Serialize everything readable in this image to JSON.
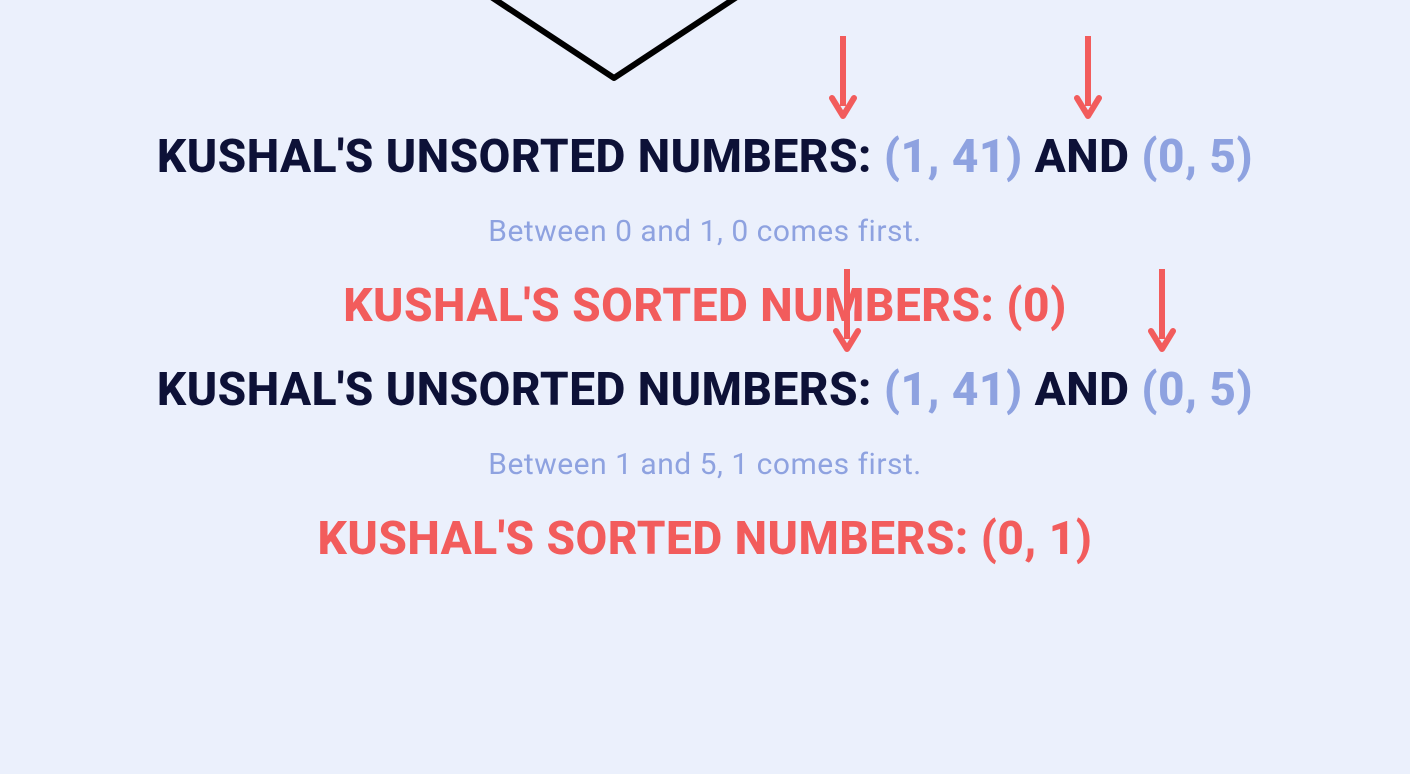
{
  "colors": {
    "bg": "#ebf0fc",
    "dark": "#0d1137",
    "accent_blue": "#8ea2e0",
    "accent_red": "#f25c5c"
  },
  "step1": {
    "unsorted_label": "KUSHAL'S UNSORTED NUMBERS: ",
    "tuple1": "(1, 41)",
    "and": " AND ",
    "tuple2": "(0, 5)",
    "explain": "Between 0 and 1, 0 comes first.",
    "sorted": "KUSHAL'S SORTED NUMBERS: (0)"
  },
  "step2": {
    "unsorted_label": "KUSHAL'S UNSORTED NUMBERS: ",
    "tuple1": "(1, 41)",
    "and": " AND ",
    "tuple2": "(0, 5)",
    "explain": "Between 1 and 5, 1 comes first.",
    "sorted": "KUSHAL'S SORTED NUMBERS: (0, 1)"
  }
}
